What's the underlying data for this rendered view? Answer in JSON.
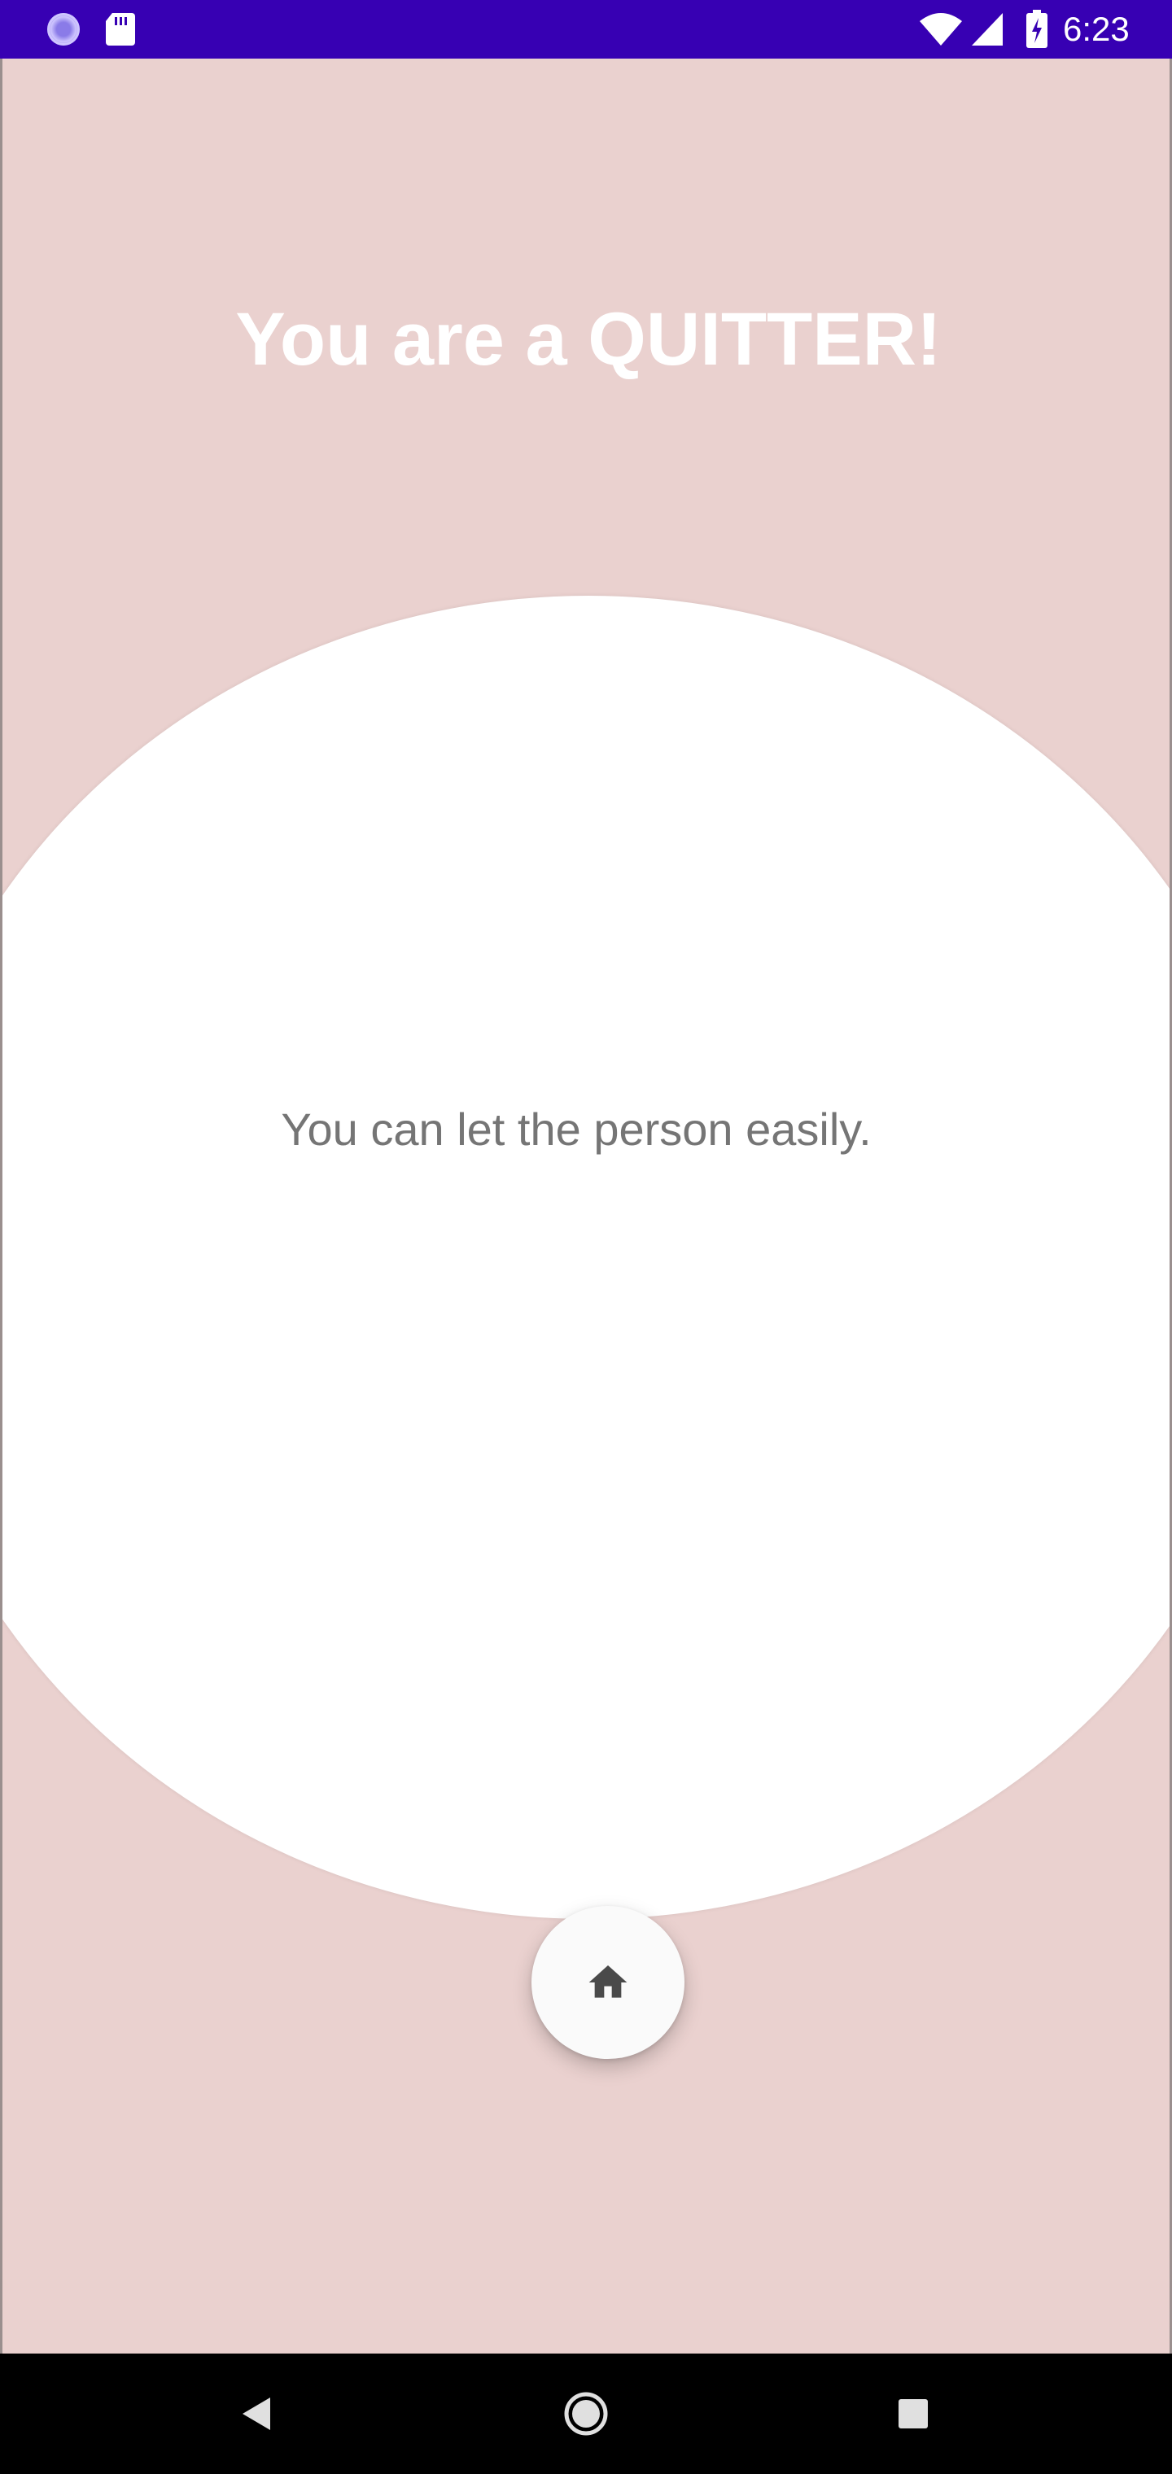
{
  "status_bar": {
    "time": "6:23",
    "icons": [
      "app-notification-icon",
      "sd-card-icon",
      "wifi-icon",
      "cell-signal-icon",
      "battery-charging-icon"
    ],
    "background_color": "#3700B3"
  },
  "screen": {
    "background_color": "#EAD1CF",
    "title": "You are a QUITTER!",
    "message": "You can let the person easily."
  },
  "home_button": {
    "icon": "home-icon"
  },
  "nav_bar": {
    "buttons": [
      "back-icon",
      "home-circle-icon",
      "recents-icon"
    ]
  }
}
